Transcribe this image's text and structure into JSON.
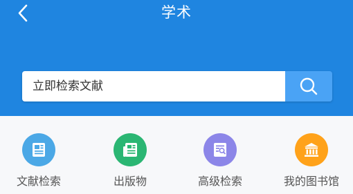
{
  "header": {
    "title": "学术",
    "back_icon": "chevron-left-icon",
    "background_color": "#1f85e0"
  },
  "search": {
    "placeholder": "立即检索文献",
    "button_icon": "search-icon",
    "button_color": "#4aa3f5"
  },
  "quick_links": [
    {
      "label": "文献检索",
      "icon": "document-list-icon",
      "color": "#4ba8e6"
    },
    {
      "label": "出版物",
      "icon": "newspaper-icon",
      "color": "#2bb673"
    },
    {
      "label": "高级检索",
      "icon": "advanced-search-icon",
      "color": "#8c86e8"
    },
    {
      "label": "我的图书馆",
      "icon": "library-building-icon",
      "color": "#ffa21a"
    }
  ]
}
